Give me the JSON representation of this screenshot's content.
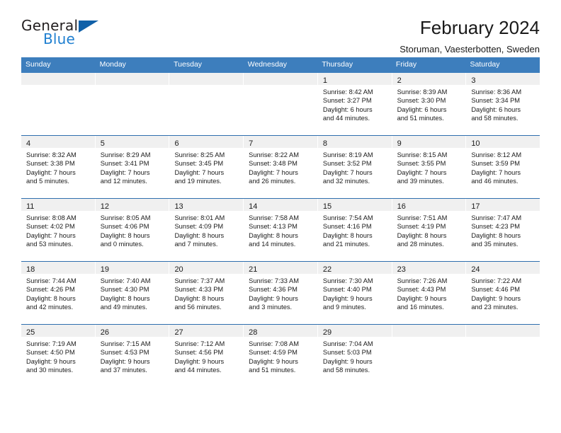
{
  "brand": {
    "name_general": "General",
    "name_blue": "Blue",
    "triangle_color": "#1060a8",
    "blue_color": "#1f7fd0"
  },
  "header": {
    "title": "February 2024",
    "subtitle": "Storuman, Vaesterbotten, Sweden"
  },
  "theme": {
    "header_row_bg": "#3d7ebd",
    "week_separator": "#2f6fae",
    "daynum_bg": "#f0f0f0"
  },
  "weekdays": [
    "Sunday",
    "Monday",
    "Tuesday",
    "Wednesday",
    "Thursday",
    "Friday",
    "Saturday"
  ],
  "weeks": [
    [
      {
        "day": "",
        "lines": []
      },
      {
        "day": "",
        "lines": []
      },
      {
        "day": "",
        "lines": []
      },
      {
        "day": "",
        "lines": []
      },
      {
        "day": "1",
        "lines": [
          "Sunrise: 8:42 AM",
          "Sunset: 3:27 PM",
          "Daylight: 6 hours",
          "and 44 minutes."
        ]
      },
      {
        "day": "2",
        "lines": [
          "Sunrise: 8:39 AM",
          "Sunset: 3:30 PM",
          "Daylight: 6 hours",
          "and 51 minutes."
        ]
      },
      {
        "day": "3",
        "lines": [
          "Sunrise: 8:36 AM",
          "Sunset: 3:34 PM",
          "Daylight: 6 hours",
          "and 58 minutes."
        ]
      }
    ],
    [
      {
        "day": "4",
        "lines": [
          "Sunrise: 8:32 AM",
          "Sunset: 3:38 PM",
          "Daylight: 7 hours",
          "and 5 minutes."
        ]
      },
      {
        "day": "5",
        "lines": [
          "Sunrise: 8:29 AM",
          "Sunset: 3:41 PM",
          "Daylight: 7 hours",
          "and 12 minutes."
        ]
      },
      {
        "day": "6",
        "lines": [
          "Sunrise: 8:25 AM",
          "Sunset: 3:45 PM",
          "Daylight: 7 hours",
          "and 19 minutes."
        ]
      },
      {
        "day": "7",
        "lines": [
          "Sunrise: 8:22 AM",
          "Sunset: 3:48 PM",
          "Daylight: 7 hours",
          "and 26 minutes."
        ]
      },
      {
        "day": "8",
        "lines": [
          "Sunrise: 8:19 AM",
          "Sunset: 3:52 PM",
          "Daylight: 7 hours",
          "and 32 minutes."
        ]
      },
      {
        "day": "9",
        "lines": [
          "Sunrise: 8:15 AM",
          "Sunset: 3:55 PM",
          "Daylight: 7 hours",
          "and 39 minutes."
        ]
      },
      {
        "day": "10",
        "lines": [
          "Sunrise: 8:12 AM",
          "Sunset: 3:59 PM",
          "Daylight: 7 hours",
          "and 46 minutes."
        ]
      }
    ],
    [
      {
        "day": "11",
        "lines": [
          "Sunrise: 8:08 AM",
          "Sunset: 4:02 PM",
          "Daylight: 7 hours",
          "and 53 minutes."
        ]
      },
      {
        "day": "12",
        "lines": [
          "Sunrise: 8:05 AM",
          "Sunset: 4:06 PM",
          "Daylight: 8 hours",
          "and 0 minutes."
        ]
      },
      {
        "day": "13",
        "lines": [
          "Sunrise: 8:01 AM",
          "Sunset: 4:09 PM",
          "Daylight: 8 hours",
          "and 7 minutes."
        ]
      },
      {
        "day": "14",
        "lines": [
          "Sunrise: 7:58 AM",
          "Sunset: 4:13 PM",
          "Daylight: 8 hours",
          "and 14 minutes."
        ]
      },
      {
        "day": "15",
        "lines": [
          "Sunrise: 7:54 AM",
          "Sunset: 4:16 PM",
          "Daylight: 8 hours",
          "and 21 minutes."
        ]
      },
      {
        "day": "16",
        "lines": [
          "Sunrise: 7:51 AM",
          "Sunset: 4:19 PM",
          "Daylight: 8 hours",
          "and 28 minutes."
        ]
      },
      {
        "day": "17",
        "lines": [
          "Sunrise: 7:47 AM",
          "Sunset: 4:23 PM",
          "Daylight: 8 hours",
          "and 35 minutes."
        ]
      }
    ],
    [
      {
        "day": "18",
        "lines": [
          "Sunrise: 7:44 AM",
          "Sunset: 4:26 PM",
          "Daylight: 8 hours",
          "and 42 minutes."
        ]
      },
      {
        "day": "19",
        "lines": [
          "Sunrise: 7:40 AM",
          "Sunset: 4:30 PM",
          "Daylight: 8 hours",
          "and 49 minutes."
        ]
      },
      {
        "day": "20",
        "lines": [
          "Sunrise: 7:37 AM",
          "Sunset: 4:33 PM",
          "Daylight: 8 hours",
          "and 56 minutes."
        ]
      },
      {
        "day": "21",
        "lines": [
          "Sunrise: 7:33 AM",
          "Sunset: 4:36 PM",
          "Daylight: 9 hours",
          "and 3 minutes."
        ]
      },
      {
        "day": "22",
        "lines": [
          "Sunrise: 7:30 AM",
          "Sunset: 4:40 PM",
          "Daylight: 9 hours",
          "and 9 minutes."
        ]
      },
      {
        "day": "23",
        "lines": [
          "Sunrise: 7:26 AM",
          "Sunset: 4:43 PM",
          "Daylight: 9 hours",
          "and 16 minutes."
        ]
      },
      {
        "day": "24",
        "lines": [
          "Sunrise: 7:22 AM",
          "Sunset: 4:46 PM",
          "Daylight: 9 hours",
          "and 23 minutes."
        ]
      }
    ],
    [
      {
        "day": "25",
        "lines": [
          "Sunrise: 7:19 AM",
          "Sunset: 4:50 PM",
          "Daylight: 9 hours",
          "and 30 minutes."
        ]
      },
      {
        "day": "26",
        "lines": [
          "Sunrise: 7:15 AM",
          "Sunset: 4:53 PM",
          "Daylight: 9 hours",
          "and 37 minutes."
        ]
      },
      {
        "day": "27",
        "lines": [
          "Sunrise: 7:12 AM",
          "Sunset: 4:56 PM",
          "Daylight: 9 hours",
          "and 44 minutes."
        ]
      },
      {
        "day": "28",
        "lines": [
          "Sunrise: 7:08 AM",
          "Sunset: 4:59 PM",
          "Daylight: 9 hours",
          "and 51 minutes."
        ]
      },
      {
        "day": "29",
        "lines": [
          "Sunrise: 7:04 AM",
          "Sunset: 5:03 PM",
          "Daylight: 9 hours",
          "and 58 minutes."
        ]
      },
      {
        "day": "",
        "lines": []
      },
      {
        "day": "",
        "lines": []
      }
    ]
  ]
}
